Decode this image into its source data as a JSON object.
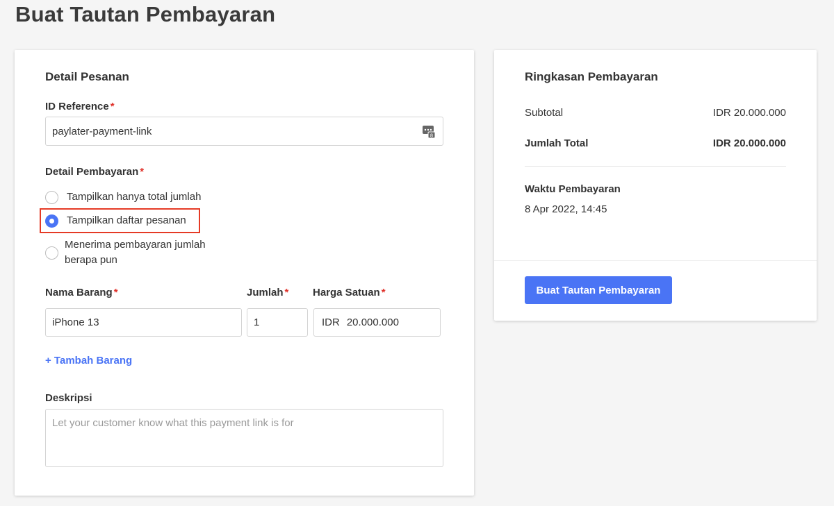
{
  "page_title": "Buat Tautan Pembayaran",
  "order": {
    "section_title": "Detail Pesanan",
    "id_reference_label": "ID Reference",
    "id_reference_value": "paylater-payment-link",
    "required_mark": "*",
    "payment_detail_label": "Detail Pembayaran",
    "options": [
      {
        "label": "Tampilkan hanya total jumlah",
        "checked": false
      },
      {
        "label": "Tampilkan daftar pesanan",
        "checked": true
      },
      {
        "label": "Menerima pembayaran jumlah berapa pun",
        "checked": false
      }
    ],
    "item_name_label": "Nama Barang",
    "qty_label": "Jumlah",
    "unit_price_label": "Harga Satuan",
    "item_name_value": "iPhone 13",
    "qty_value": "1",
    "currency": "IDR",
    "unit_price_value": "20.000.000",
    "add_item_link": "+ Tambah Barang",
    "description_label": "Deskripsi",
    "description_placeholder": "Let your customer know what this payment link is for"
  },
  "summary": {
    "section_title": "Ringkasan Pembayaran",
    "subtotal_label": "Subtotal",
    "subtotal_value": "IDR 20.000.000",
    "total_label": "Jumlah Total",
    "total_value": "IDR 20.000.000",
    "payment_time_label": "Waktu Pembayaran",
    "payment_time_value": "8 Apr 2022, 14:45",
    "create_button": "Buat Tautan Pembayaran"
  },
  "colors": {
    "accent": "#4a74f5",
    "required": "#e0322b",
    "highlight": "#e53a25"
  }
}
